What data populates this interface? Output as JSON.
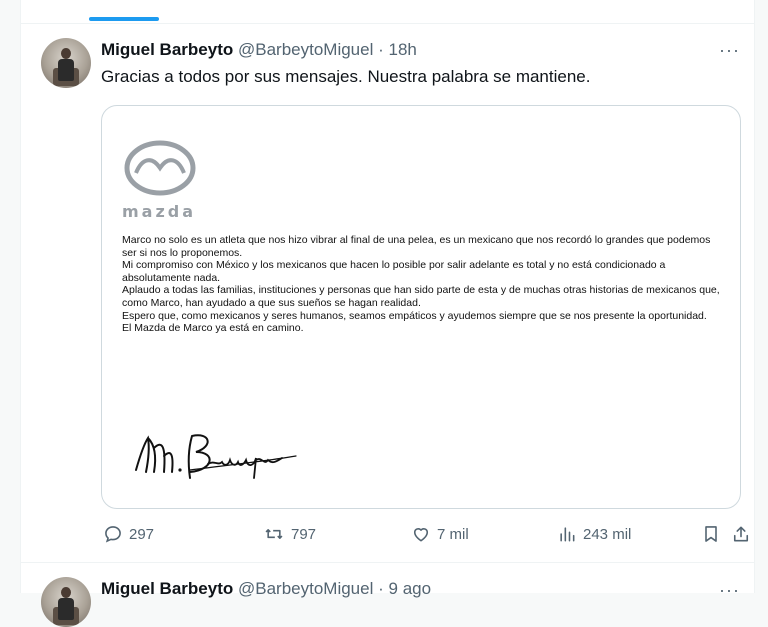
{
  "tweet": {
    "author_name": "Miguel Barbeyto",
    "handle": "@BarbeytoMiguel",
    "separator": "·",
    "time": "18h",
    "more": "···",
    "text": "Gracias a todos por sus mensajes. Nuestra palabra se mantiene.",
    "image": {
      "logo_text": "mazda",
      "paragraphs": [
        "Marco no solo es un atleta que nos hizo vibrar al final de una pelea, es un mexicano que nos recordó lo grandes que podemos ser si nos lo proponemos.",
        "Mi compromiso con México y los mexicanos que hacen lo posible por salir adelante es total y no está condicionado a absolutamente nada.",
        "Aplaudo a todas las familias, instituciones y personas que han sido parte de esta y de muchas otras historias de mexicanos que, como Marco, han ayudado a que sus sueños se hagan realidad.",
        "Espero que, como mexicanos y seres humanos, seamos empáticos y ayudemos siempre que se nos presente la oportunidad.",
        "El Mazda de Marco ya está en camino."
      ],
      "signature": "M. Barbeyto"
    },
    "actions": {
      "replies": "297",
      "retweets": "797",
      "likes": "7 mil",
      "views": "243 mil"
    }
  },
  "next_tweet": {
    "author_name": "Miguel Barbeyto",
    "handle": "@BarbeytoMiguel",
    "separator": "·",
    "time": "9 ago",
    "more": "···"
  },
  "colors": {
    "accent": "#1d9bf0",
    "text": "#0f1419",
    "muted": "#536471",
    "border": "#cfd9de"
  }
}
